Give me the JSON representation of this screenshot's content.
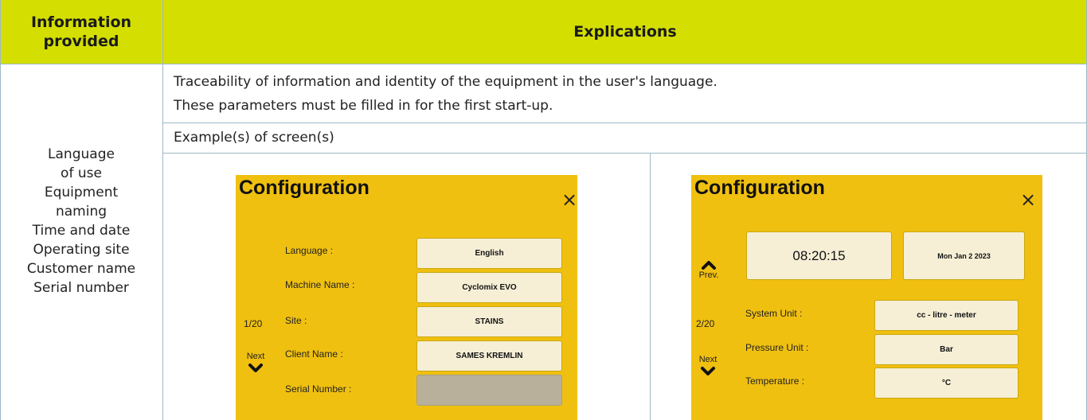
{
  "header": {
    "col1": "Information provided",
    "col2": "Explications"
  },
  "left_items": [
    "Language",
    "of use",
    "Equipment",
    "naming",
    "Time and date",
    "Operating site",
    "Customer name",
    "Serial number"
  ],
  "explication": {
    "line1": "Traceability of information and identity of the equipment in the user's language.",
    "line2": "These parameters must be filled in for the first start-up.",
    "example_heading": "Example(s) of screen(s)"
  },
  "screen1": {
    "title": "Configuration",
    "close_glyph": "×",
    "page": "1/20",
    "next_label": "Next",
    "fields": [
      {
        "label": "Language :",
        "value": "English"
      },
      {
        "label": "Machine Name :",
        "value": "Cyclomix EVO"
      },
      {
        "label": "Site :",
        "value": "STAINS"
      },
      {
        "label": "Client Name :",
        "value": "SAMES KREMLIN"
      },
      {
        "label": "Serial Number :",
        "value": ""
      }
    ]
  },
  "screen2": {
    "title": "Configuration",
    "close_glyph": "×",
    "time": "08:20:15",
    "date": "Mon Jan 2 2023",
    "prev_label": "Prev.",
    "page": "2/20",
    "next_label": "Next",
    "fields": [
      {
        "label": "System Unit :",
        "value": "cc - litre - meter"
      },
      {
        "label": "Pressure Unit :",
        "value": "Bar"
      },
      {
        "label": "Temperature :",
        "value": "°C"
      }
    ]
  },
  "colors": {
    "header_bg": "#d4de00",
    "screen_bg": "#f0c010",
    "grid_line": "#9fb9c6"
  }
}
